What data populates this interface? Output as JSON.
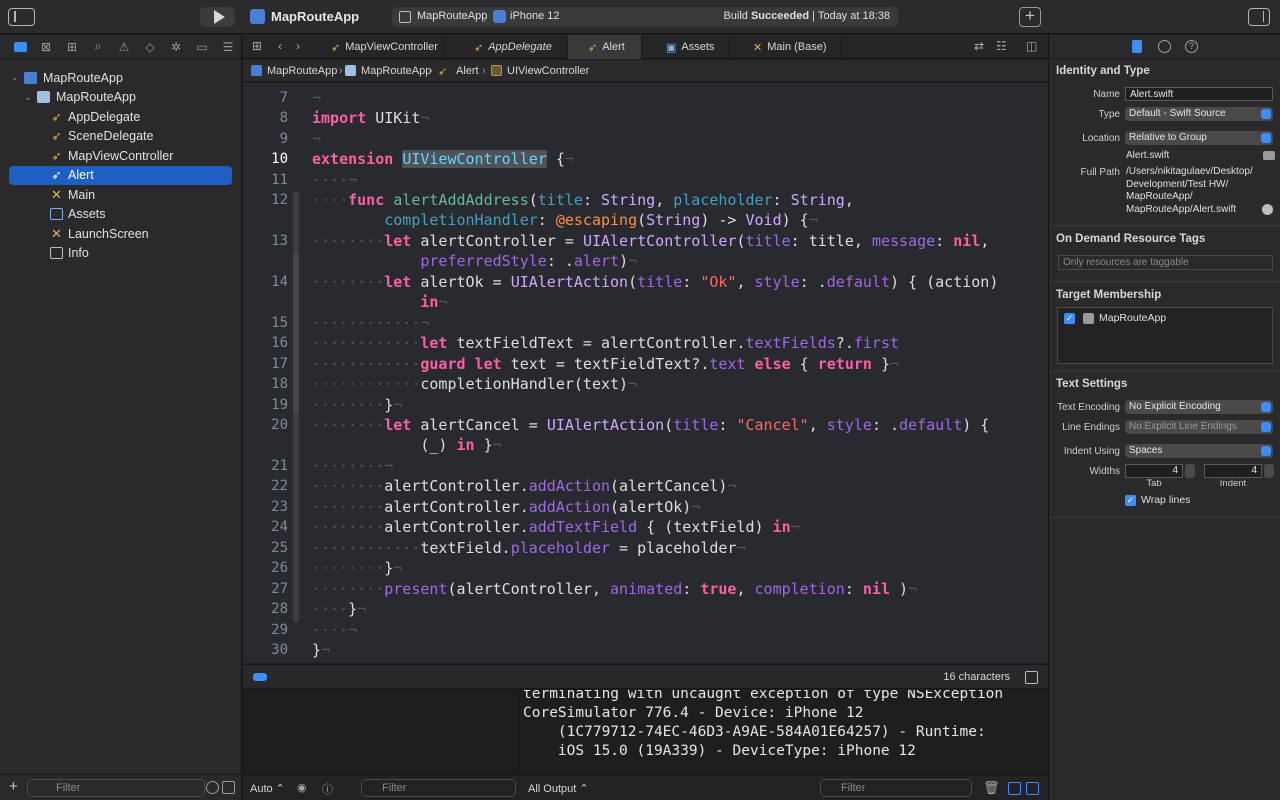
{
  "toolbar": {
    "project_name": "MapRouteApp",
    "scheme_target": "MapRouteApp",
    "scheme_sep": "〉",
    "scheme_device": "iPhone 12",
    "status_prefix": "Build ",
    "status_bold": "Succeeded",
    "status_suffix": " | Today at 18:38",
    "add_label": "+"
  },
  "navigator": {
    "tree": [
      {
        "label": "MapRouteApp",
        "icon": "project-icon",
        "chevron": "⌄",
        "level": 0
      },
      {
        "label": "MapRouteApp",
        "icon": "folder-icon",
        "chevron": "⌄",
        "level": 1
      },
      {
        "label": "AppDelegate",
        "icon": "swift-file-icon",
        "level": 2
      },
      {
        "label": "SceneDelegate",
        "icon": "swift-file-icon",
        "level": 2
      },
      {
        "label": "MapViewController",
        "icon": "swift-file-icon",
        "level": 2
      },
      {
        "label": "Alert",
        "icon": "swift-file-icon",
        "level": 2,
        "selected": true
      },
      {
        "label": "Main",
        "icon": "storyboard-icon",
        "level": 2
      },
      {
        "label": "Assets",
        "icon": "assets-icon",
        "level": 2
      },
      {
        "label": "LaunchScreen",
        "icon": "storyboard-icon",
        "level": 2
      },
      {
        "label": "Info",
        "icon": "plist-icon",
        "level": 2
      }
    ],
    "filter_placeholder": "Filter",
    "add_label": "+"
  },
  "editor": {
    "tabs": [
      {
        "label": "MapViewController",
        "icon": "swift-file-icon"
      },
      {
        "label": "AppDelegate",
        "icon": "swift-file-icon",
        "italic": true
      },
      {
        "label": "Alert",
        "icon": "swift-file-icon",
        "active": true
      },
      {
        "label": "Assets",
        "icon": "assets-icon"
      },
      {
        "label": "Main (Base)",
        "icon": "storyboard-icon"
      }
    ],
    "breadcrumb": [
      "MapRouteApp",
      "MapRouteApp",
      "Alert",
      "UIViewController"
    ],
    "line_numbers": [
      "7",
      "8",
      "9",
      "10",
      "11",
      "12",
      "13",
      "14",
      "15",
      "16",
      "17",
      "18",
      "19",
      "20",
      "21",
      "22",
      "23",
      "24",
      "25",
      "26",
      "27",
      "28",
      "29",
      "30"
    ],
    "current_line": "10",
    "status_chars": "16 characters"
  },
  "console": {
    "lines": [
      "terminating with uncaught exception of type NSException",
      "CoreSimulator 776.4 - Device: iPhone 12",
      "    (1C779712-74EC-46D3-A9AE-584A01E64257) - Runtime:",
      "    iOS 15.0 (19A339) - DeviceType: iPhone 12"
    ],
    "auto_label": "Auto ⌃",
    "output_label": "All Output ⌃",
    "filter_placeholder": "Filter"
  },
  "inspector": {
    "identity_title": "Identity and Type",
    "name_label": "Name",
    "name_value": "Alert.swift",
    "type_label": "Type",
    "type_value": "Default - Swift Source",
    "location_label": "Location",
    "location_value": "Relative to Group",
    "location_file": "Alert.swift",
    "fullpath_label": "Full Path",
    "fullpath_lines": [
      "/Users/nikitagulaev/Desktop/",
      "Development/Test HW/",
      "MapRouteApp/",
      "MapRouteApp/Alert.swift"
    ],
    "odr_title": "On Demand Resource Tags",
    "odr_placeholder": "Only resources are taggable",
    "target_title": "Target Membership",
    "target_name": "MapRouteApp",
    "text_title": "Text Settings",
    "encoding_label": "Text Encoding",
    "encoding_value": "No Explicit Encoding",
    "endings_label": "Line Endings",
    "endings_value": "No Explicit Line Endings",
    "indent_label": "Indent Using",
    "indent_value": "Spaces",
    "widths_label": "Widths",
    "tab_width": "4",
    "indent_width": "4",
    "tab_caption": "Tab",
    "indent_caption": "Indent",
    "wrap_label": "Wrap lines"
  }
}
